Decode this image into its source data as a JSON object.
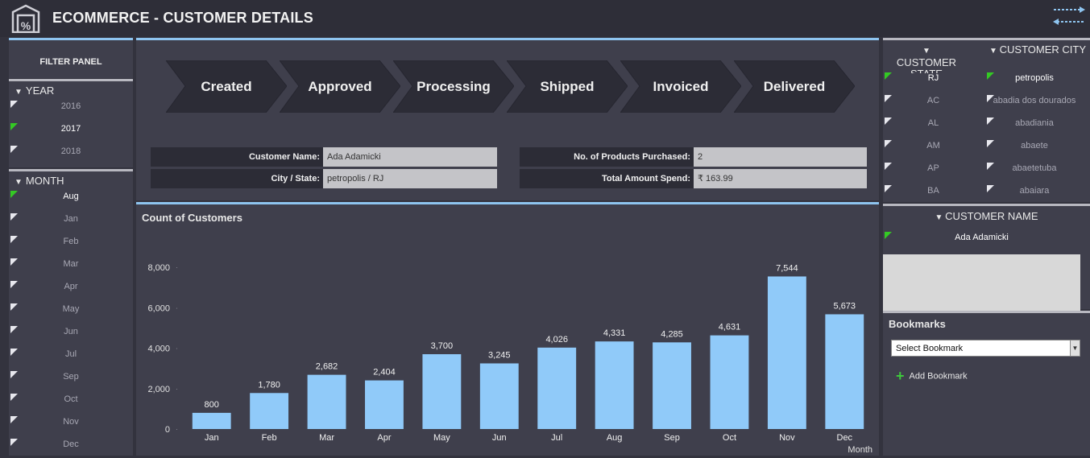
{
  "header": {
    "title": "ECOMMERCE - CUSTOMER DETAILS",
    "logo_icon": "store-percent-icon",
    "swap_icon": "swap-arrows-icon"
  },
  "filter_panel": {
    "title": "FILTER PANEL"
  },
  "year_slicer": {
    "header": "YEAR",
    "items": [
      {
        "label": "2016",
        "selected": false
      },
      {
        "label": "2017",
        "selected": true
      },
      {
        "label": "2018",
        "selected": false
      }
    ]
  },
  "month_slicer": {
    "header": "MONTH",
    "items": [
      {
        "label": "Aug",
        "selected": true
      },
      {
        "label": "Jan",
        "selected": false
      },
      {
        "label": "Feb",
        "selected": false
      },
      {
        "label": "Mar",
        "selected": false
      },
      {
        "label": "Apr",
        "selected": false
      },
      {
        "label": "May",
        "selected": false
      },
      {
        "label": "Jun",
        "selected": false
      },
      {
        "label": "Jul",
        "selected": false
      },
      {
        "label": "Sep",
        "selected": false
      },
      {
        "label": "Oct",
        "selected": false
      },
      {
        "label": "Nov",
        "selected": false
      },
      {
        "label": "Dec",
        "selected": false
      }
    ]
  },
  "process_steps": [
    "Created",
    "Approved",
    "Processing",
    "Shipped",
    "Invoiced",
    "Delivered"
  ],
  "customer_info": {
    "name_label": "Customer Name:",
    "name_value": "Ada Adamicki",
    "city_label": "City / State:",
    "city_value": "petropolis / RJ",
    "products_label": "No. of Products Purchased:",
    "products_value": "2",
    "amount_label": "Total Amount Spend:",
    "amount_value": "₹ 163.99"
  },
  "chart_data": {
    "type": "bar",
    "title": "Count of Customers",
    "xlabel": "Month",
    "ylabel": "",
    "categories": [
      "Jan",
      "Feb",
      "Mar",
      "Apr",
      "May",
      "Jun",
      "Jul",
      "Aug",
      "Sep",
      "Oct",
      "Nov",
      "Dec"
    ],
    "values": [
      800,
      1780,
      2682,
      2404,
      3700,
      3245,
      4026,
      4331,
      4285,
      4631,
      7544,
      5673
    ],
    "data_labels": [
      "800",
      "1,780",
      "2,682",
      "2,404",
      "3,700",
      "3,245",
      "4,026",
      "4,331",
      "4,285",
      "4,631",
      "7,544",
      "5,673"
    ],
    "yticks": [
      "0",
      "2,000",
      "4,000",
      "6,000",
      "8,000"
    ],
    "ylim": [
      0,
      8000
    ],
    "bar_color": "#90caf9",
    "grid": false
  },
  "customer_state": {
    "header": "CUSTOMER STATE",
    "items": [
      {
        "label": "RJ",
        "selected": true
      },
      {
        "label": "AC",
        "selected": false
      },
      {
        "label": "AL",
        "selected": false
      },
      {
        "label": "AM",
        "selected": false
      },
      {
        "label": "AP",
        "selected": false
      },
      {
        "label": "BA",
        "selected": false
      }
    ]
  },
  "customer_city": {
    "header": "CUSTOMER CITY",
    "items": [
      {
        "label": "petropolis",
        "selected": true
      },
      {
        "label": "abadia dos dourados",
        "selected": false
      },
      {
        "label": "abadiania",
        "selected": false
      },
      {
        "label": "abaete",
        "selected": false
      },
      {
        "label": "abaetetuba",
        "selected": false
      },
      {
        "label": "abaiara",
        "selected": false
      }
    ]
  },
  "customer_name": {
    "header": "CUSTOMER NAME",
    "items": [
      {
        "label": "Ada Adamicki",
        "selected": true
      }
    ]
  },
  "bookmarks": {
    "title": "Bookmarks",
    "select_label": "Select Bookmark",
    "add_label": "Add Bookmark"
  },
  "colors": {
    "accent": "#8ec4ef",
    "selected_flag": "#34c924",
    "background": "#33333e",
    "panel": "#3f3f4c"
  }
}
